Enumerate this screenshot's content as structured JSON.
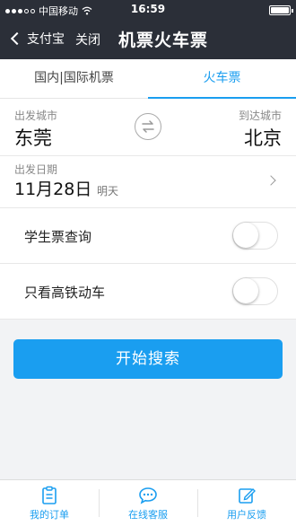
{
  "status_bar": {
    "carrier": "中国移动",
    "time": "16:59"
  },
  "nav": {
    "back_label": "支付宝",
    "close_label": "关闭",
    "title": "机票火车票"
  },
  "tabs": [
    {
      "label": "国内|国际机票",
      "active": false
    },
    {
      "label": "火车票",
      "active": true
    }
  ],
  "form": {
    "from_label": "出发城市",
    "from_value": "东莞",
    "to_label": "到达城市",
    "to_value": "北京",
    "date_label": "出发日期",
    "date_value": "11月28日",
    "date_sub": "明天",
    "student_label": "学生票查询",
    "highspeed_label": "只看高铁动车",
    "search_label": "开始搜索"
  },
  "bottom_bar": [
    {
      "label": "我的订单",
      "icon": "clipboard-icon"
    },
    {
      "label": "在线客服",
      "icon": "chat-icon"
    },
    {
      "label": "用户反馈",
      "icon": "edit-icon"
    }
  ],
  "colors": {
    "accent": "#1a9ef0",
    "header": "#2b2f38"
  }
}
